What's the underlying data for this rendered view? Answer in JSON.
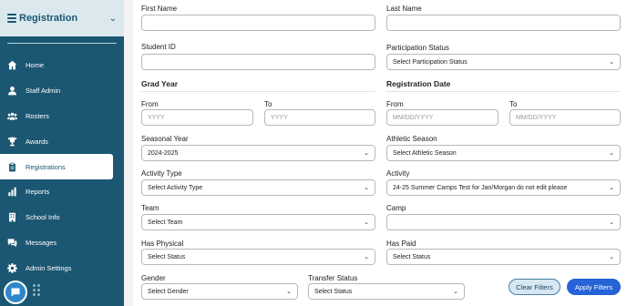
{
  "sidebar": {
    "title": "Registration",
    "items": [
      {
        "label": "Home",
        "icon": "home-icon"
      },
      {
        "label": "Staff Admin",
        "icon": "person-icon"
      },
      {
        "label": "Rosters",
        "icon": "group-icon"
      },
      {
        "label": "Awards",
        "icon": "trophy-icon"
      },
      {
        "label": "Registrations",
        "icon": "clipboard-icon",
        "active": true
      },
      {
        "label": "Reports",
        "icon": "bar-chart-icon"
      },
      {
        "label": "School Info",
        "icon": "building-icon"
      },
      {
        "label": "Messages",
        "icon": "chat-icon"
      },
      {
        "label": "Admin Settings",
        "icon": "gear-icon"
      }
    ]
  },
  "form": {
    "first_name_label": "First Name",
    "last_name_label": "Last Name",
    "student_id_label": "Student ID",
    "participation_status_label": "Participation Status",
    "participation_status_value": "Select Participation Status",
    "grad_year_label": "Grad Year",
    "registration_date_label": "Registration Date",
    "grad_from_label": "From",
    "grad_from_placeholder": "YYYY",
    "grad_to_label": "To",
    "grad_to_placeholder": "YYYY",
    "reg_from_label": "From",
    "reg_from_placeholder": "MM/DD/YYYY",
    "reg_to_label": "To",
    "reg_to_placeholder": "MM/DD/YYYY",
    "seasonal_year_label": "Seasonal Year",
    "seasonal_year_value": "2024-2025",
    "athletic_season_label": "Athletic Season",
    "athletic_season_value": "Select Athletic Season",
    "activity_type_label": "Activity Type",
    "activity_type_value": "Select Activity Type",
    "activity_label": "Activity",
    "activity_value": "24-25 Summer Camps Test for Jan/Morgan do not edit please",
    "team_label": "Team",
    "team_value": "Select Team",
    "camp_label": "Camp",
    "camp_value": "",
    "has_physical_label": "Has Physical",
    "has_physical_value": "Select Status",
    "has_paid_label": "Has Paid",
    "has_paid_value": "Select Status",
    "gender_label": "Gender",
    "gender_value": "Select Gender",
    "transfer_status_label": "Transfer Status",
    "transfer_status_value": "Select Status",
    "clear_label": "Clear Filters",
    "apply_label": "Apply Filters"
  },
  "colors": {
    "sidebar_bg": "#1b5772",
    "sidebar_header_bg": "#dbe9ef",
    "apply_button": "#2563d6",
    "clear_button": "#d6e7f2"
  }
}
